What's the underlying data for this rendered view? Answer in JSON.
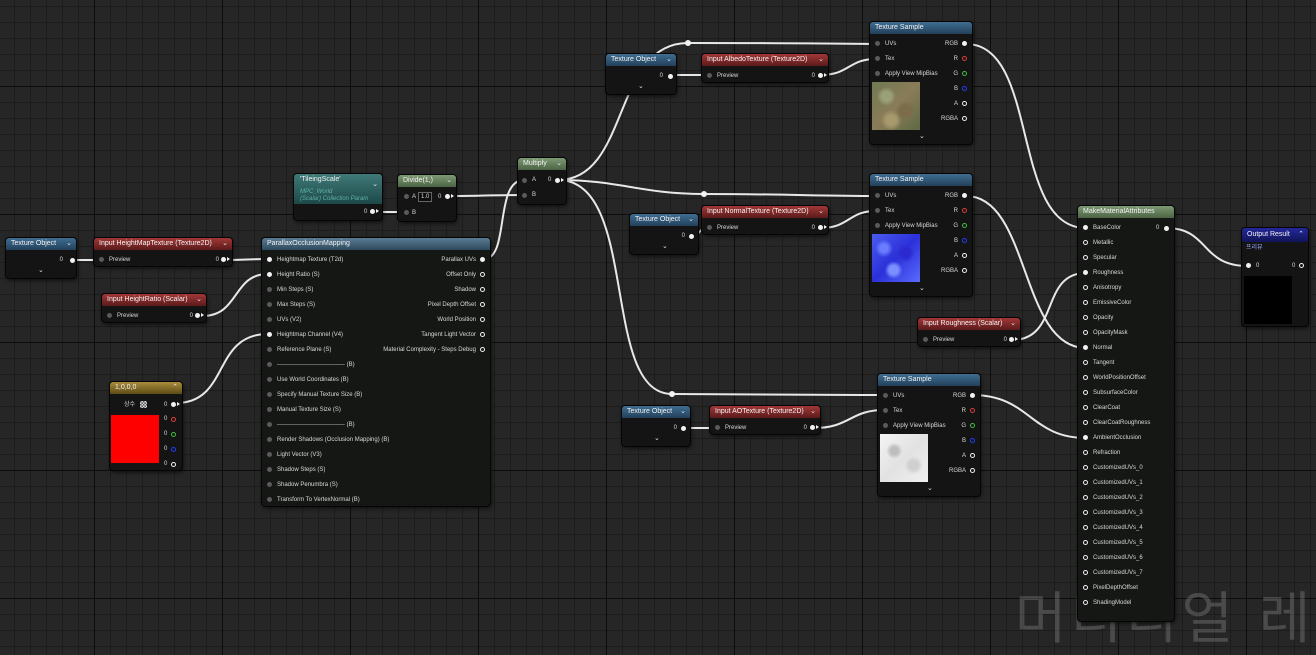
{
  "colors": {
    "wire": "#e8e8e8",
    "pin_red": "#e04040",
    "pin_green": "#40c040",
    "pin_blue": "#2040ff",
    "red_preview": "#ff0000",
    "output_bg": "#000000"
  },
  "texture_object": {
    "title": "Texture Object",
    "out": "0"
  },
  "heightmap": {
    "title": "Input HeightMapTexture (Texture2D)",
    "preview": "Preview",
    "out": "0"
  },
  "heightratio": {
    "title": "Input HeightRatio (Scalar)",
    "preview": "Preview",
    "out": "0"
  },
  "constant": {
    "title": "1,0,0,0",
    "label": "상수",
    "out": "0"
  },
  "tiling": {
    "title": "'TileingScale'",
    "sub1": "MPC_World",
    "sub2": "(Scalar) Collection Param",
    "out": "0"
  },
  "divide": {
    "title": "Divide(1,)",
    "val": "1.0",
    "a": "A",
    "b": "B",
    "out": "0"
  },
  "multiply": {
    "title": "Multiply",
    "a": "A",
    "b": "B",
    "out": "0"
  },
  "pom": {
    "title": "ParallaxOcclusionMapping",
    "inputs": [
      "Heightmap Texture (T2d)",
      "Height Ratio (S)",
      "Min Steps (S)",
      "Max Steps (S)",
      "UVs (V2)",
      "Heightmap Channel (V4)",
      "Reference Plane (S)",
      "---------------------------------- (B)",
      "Use World Coordinates (B)",
      "Specify Manual Texture Size (B)",
      "Manual Texture Size (S)",
      "---------------------------------- (B)",
      "Render Shadows (Occlusion Mapping) (B)",
      "Light Vector (V3)",
      "Shadow Steps (S)",
      "Shadow Penumbra (S)",
      "Transform To VertexNormal (B)"
    ],
    "outputs": [
      "Parallax UVs",
      "Offset Only",
      "Shadow",
      "Pixel Depth Offset",
      "World Position",
      "Tangent Light Vector",
      "Material Complexity - Steps Debug"
    ]
  },
  "albedo_obj": {
    "title": "Texture Object",
    "out": "0"
  },
  "albedo_input": {
    "title": "Input AlbedoTexture (Texture2D)",
    "preview": "Preview",
    "out": "0"
  },
  "normal_obj": {
    "title": "Texture Object",
    "out": "0"
  },
  "normal_input": {
    "title": "Input NormalTexture (Texture2D)",
    "preview": "Preview",
    "out": "0"
  },
  "ao_obj": {
    "title": "Texture Object",
    "out": "0"
  },
  "ao_input": {
    "title": "Input AOTexture (Texture2D)",
    "preview": "Preview",
    "out": "0"
  },
  "ts": {
    "title": "Texture Sample",
    "inputs": [
      "UVs",
      "Tex",
      "Apply View MipBias"
    ],
    "outputs": [
      "RGB",
      "R",
      "G",
      "B",
      "A",
      "RGBA"
    ]
  },
  "roughness": {
    "title": "Input Roughness (Scalar)",
    "preview": "Preview",
    "out": "0"
  },
  "mma": {
    "title": "MakeMaterialAttributes",
    "out": "0",
    "inputs": [
      "BaseColor",
      "Metallic",
      "Specular",
      "Roughness",
      "Anisotropy",
      "EmissiveColor",
      "Opacity",
      "OpacityMask",
      "Normal",
      "Tangent",
      "WorldPositionOffset",
      "SubsurfaceColor",
      "ClearCoat",
      "ClearCoatRoughness",
      "AmbientOcclusion",
      "Refraction",
      "CustomizedUVs_0",
      "CustomizedUVs_1",
      "CustomizedUVs_2",
      "CustomizedUVs_3",
      "CustomizedUVs_4",
      "CustomizedUVs_5",
      "CustomizedUVs_6",
      "CustomizedUVs_7",
      "PixelDepthOffset",
      "ShadingModel"
    ]
  },
  "output": {
    "title": "Output Result",
    "sub": "프리뷰",
    "in": "0",
    "out": "0"
  },
  "watermark": "머티리얼 레"
}
